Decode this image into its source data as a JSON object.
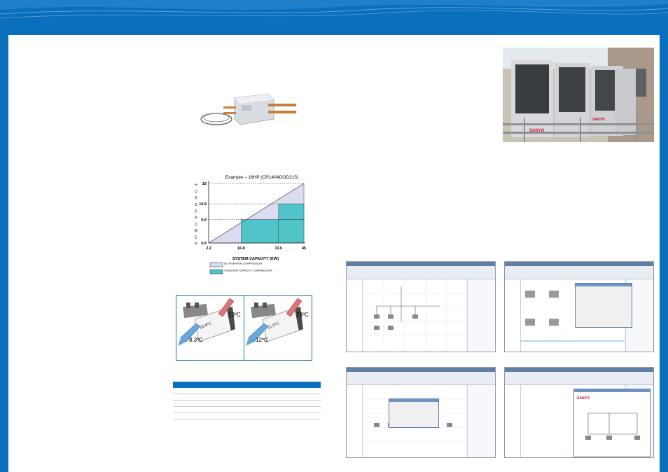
{
  "chart_data": {
    "type": "area",
    "title": "Example – 16HP  (CR1404GOD215)",
    "xlabel": "SYSTEM CAPACITY (KW)",
    "ylabel": "HORSEPOWER",
    "ylabel_letters": [
      "H",
      "O",
      "R",
      "S",
      "E",
      "P",
      "O",
      "W",
      "E",
      "R"
    ],
    "x_ticks": [
      "2.2",
      "16.8",
      "33.6",
      "45"
    ],
    "y_ticks": [
      "16",
      "10.8",
      "6.8",
      "0.8"
    ],
    "x_values": [
      2.2,
      16.8,
      33.6,
      45
    ],
    "y_values": [
      0.8,
      6.8,
      10.8,
      16
    ],
    "legend": [
      {
        "label": "DC INVERTER COMPRESSOR",
        "color": "#dcdcf0"
      },
      {
        "label": "CONSTANT CAPACITY COMPRESSOR",
        "color": "#4fc4c9"
      }
    ]
  },
  "temps": {
    "left": {
      "inlet": "23ºC",
      "coil": "16.6ºC",
      "outlet": "8.3ºC"
    },
    "right": {
      "inlet": "23ºC",
      "coil": "11.0ºC",
      "outlet": "12ºC"
    }
  },
  "colors": {
    "brand": "#0a6fbd",
    "inverter": "#dcdcf0",
    "constant": "#4fc4c9",
    "arrow_hot": "#d9767a",
    "arrow_cold": "#6aa7dc"
  },
  "photo": {
    "brand_text": "SANYO"
  }
}
